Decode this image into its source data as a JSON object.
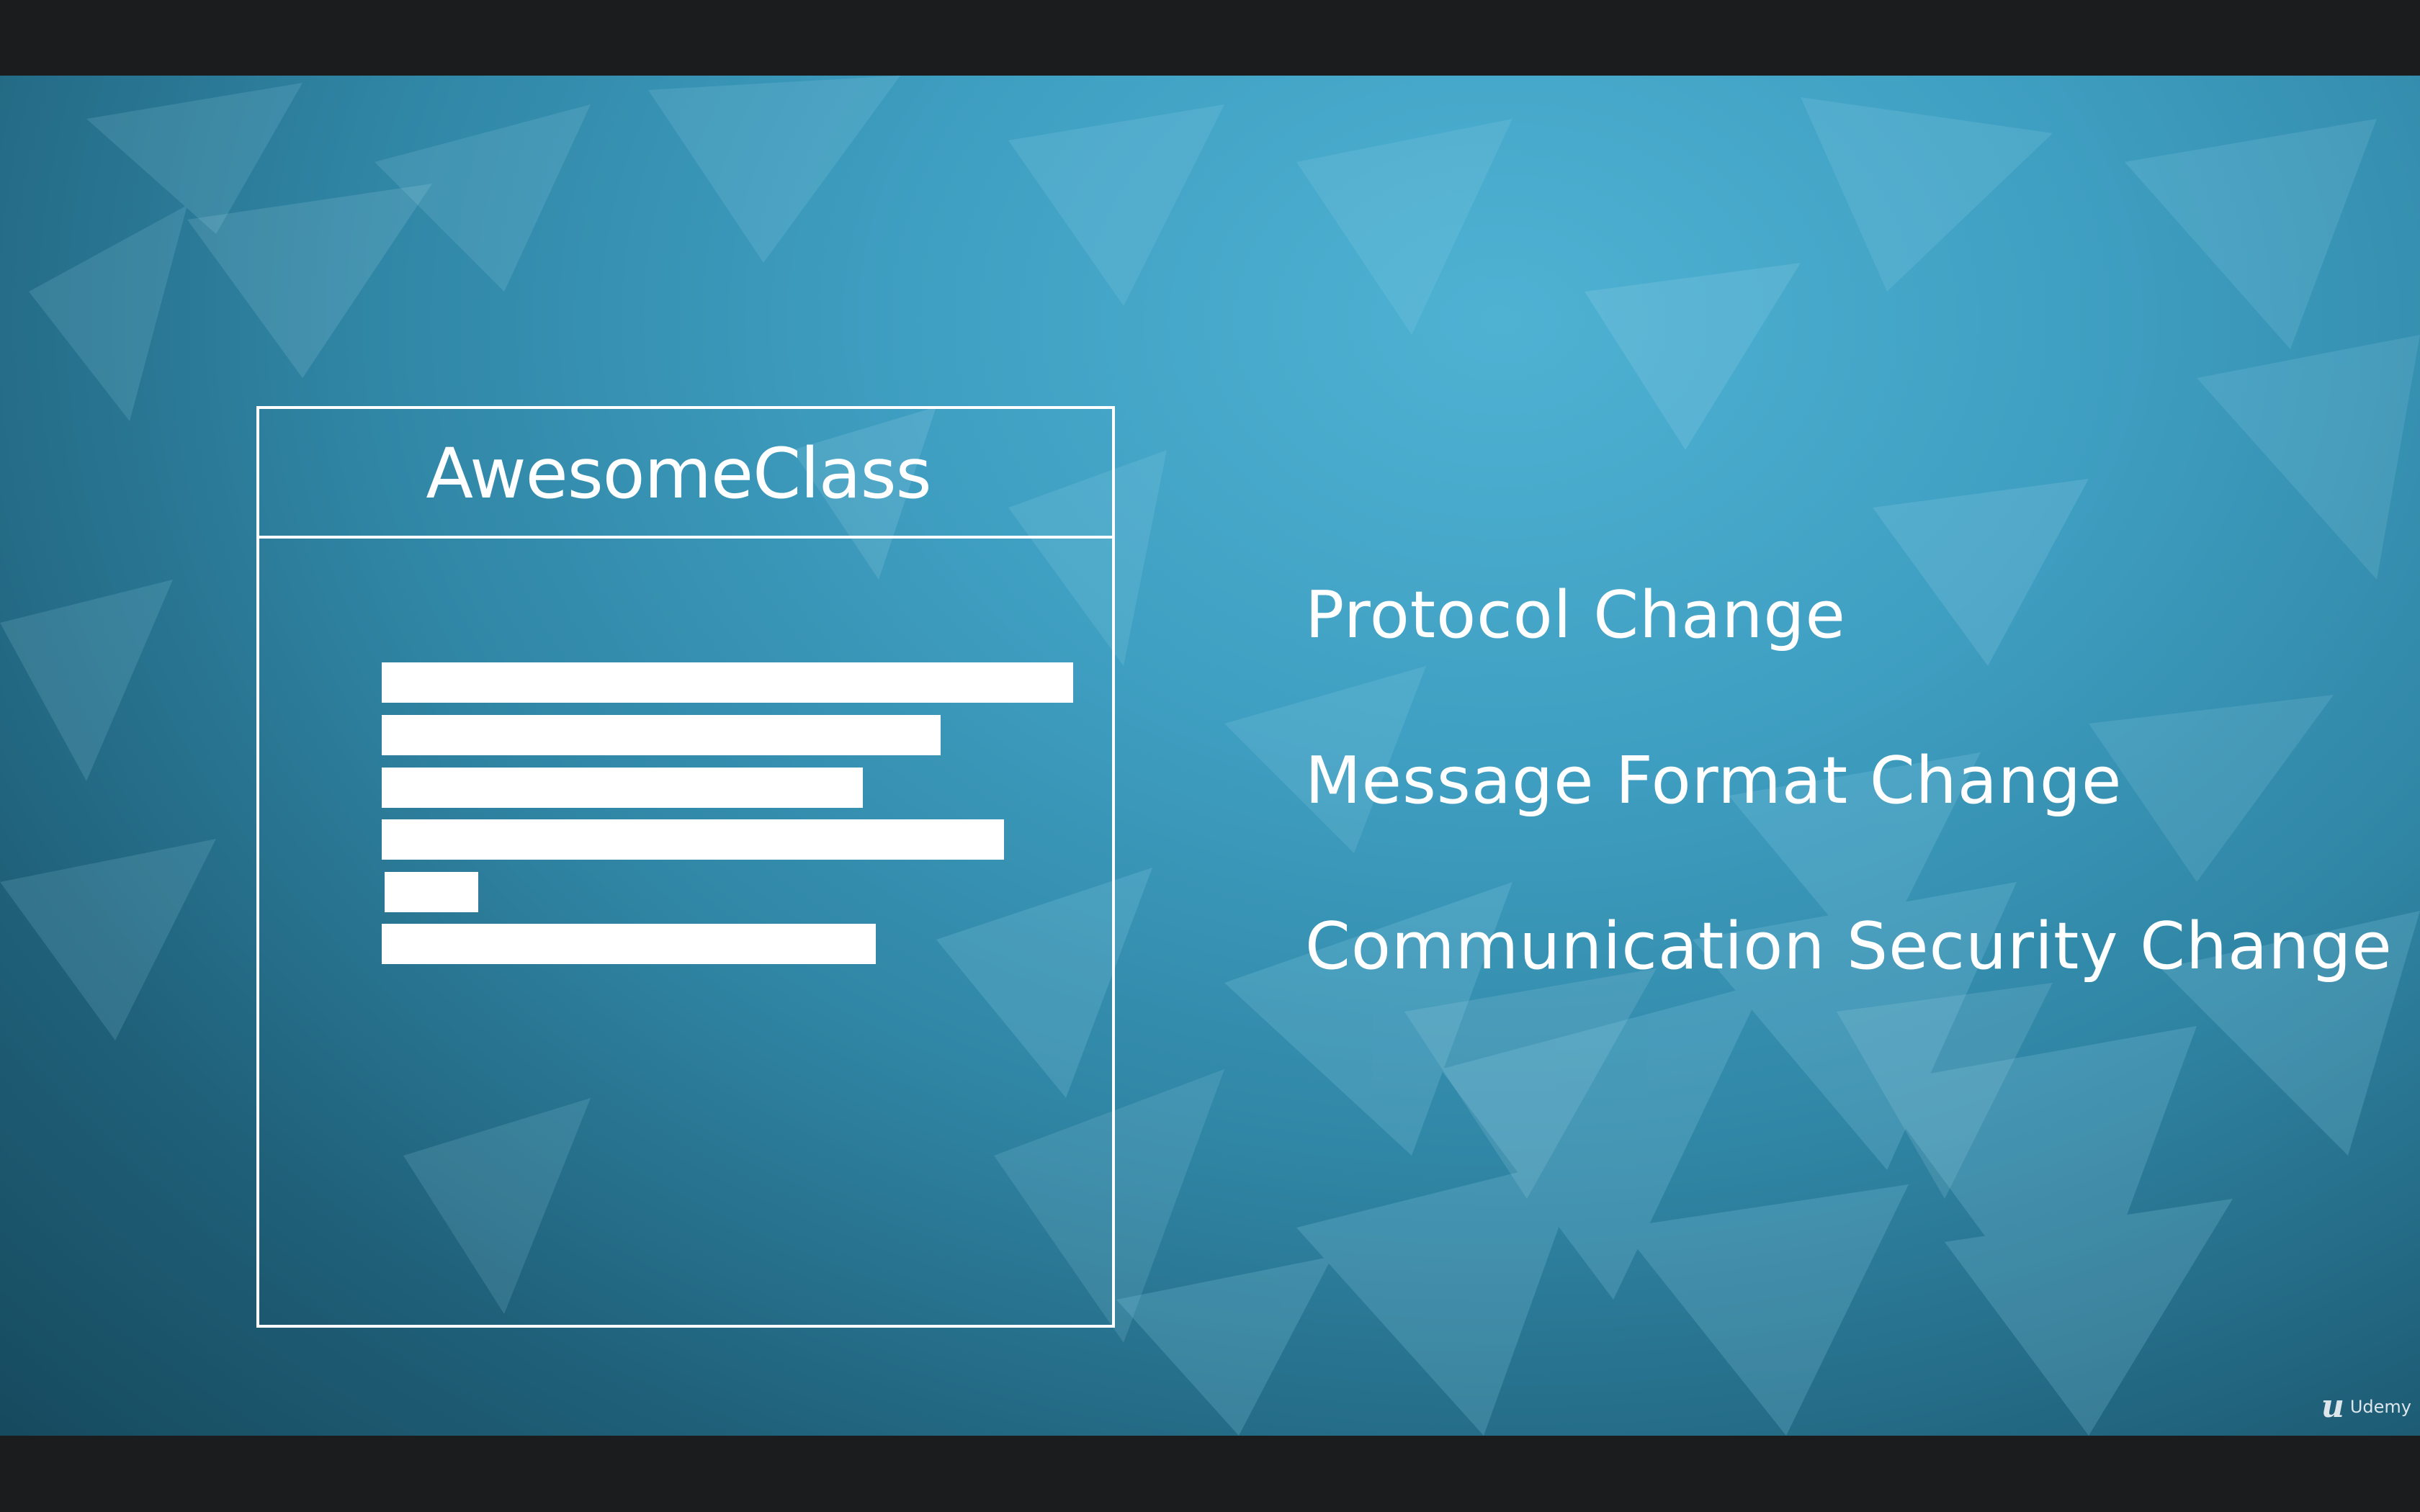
{
  "slide": {
    "class_box": {
      "title": "AwesomeClass",
      "line_bar_count": 6
    },
    "changes": [
      "Protocol Change",
      "Message Format Change",
      "Communication Security Change"
    ]
  },
  "brand": {
    "icon": "udemy-logo-icon",
    "label": "Udemy"
  },
  "colors": {
    "background_light": "#4fb2d3",
    "background_dark": "#164a5e",
    "foreground": "#ffffff",
    "letterbox": "#1b1c1e"
  }
}
